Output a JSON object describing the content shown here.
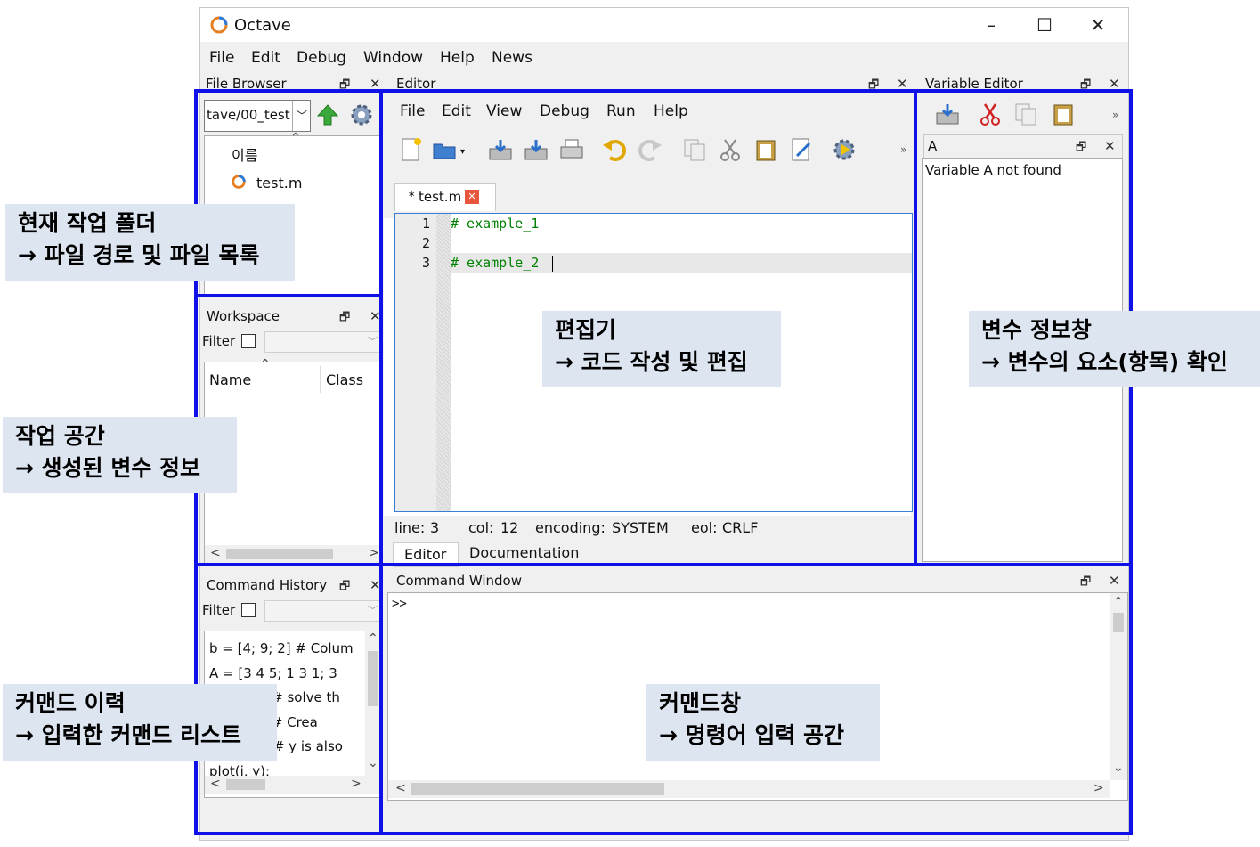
{
  "window": {
    "title": "Octave",
    "minimize": "–",
    "maximize": "☐",
    "close": "✕"
  },
  "menu": [
    "File",
    "Edit",
    "Debug",
    "Window",
    "Help",
    "News"
  ],
  "file_browser": {
    "title": "File Browser",
    "path": "tave/00_test",
    "column": "이름",
    "files": [
      "test.m"
    ]
  },
  "workspace": {
    "title": "Workspace",
    "filter_label": "Filter",
    "columns": [
      "Name",
      "Class"
    ]
  },
  "history": {
    "title": "Command History",
    "filter_label": "Filter",
    "items": [
      "b = [4; 9; 2] # Colum",
      "A = [3 4 5; 1 3 1; 3",
      "x = A \\ b # solve th",
      "i = 1:10; # Crea",
      "y = i.^2; # y is also",
      "plot(i, y);"
    ]
  },
  "editor": {
    "title": "Editor",
    "menu": [
      "File",
      "Edit",
      "View",
      "Debug",
      "Run",
      "Help"
    ],
    "tab": "test.m",
    "tab_marker": "∗",
    "lines": [
      {
        "num": "1",
        "text": "# example_1"
      },
      {
        "num": "2",
        "text": ""
      },
      {
        "num": "3",
        "text": "# example_2"
      }
    ],
    "status": {
      "line_label": "line:",
      "line": "3",
      "col_label": "col:",
      "col": "12",
      "enc_label": "encoding:",
      "enc": "SYSTEM",
      "eol_label": "eol:",
      "eol": "CRLF"
    },
    "bottom_tabs": [
      "Editor",
      "Documentation"
    ],
    "more": "»"
  },
  "variable_editor": {
    "title": "Variable Editor",
    "var_tab": "A",
    "message": "Variable A not found",
    "more": "»"
  },
  "command_window": {
    "title": "Command Window",
    "prompt": ">>"
  },
  "annotations": {
    "folder": [
      "현재 작업 폴더",
      "→ 파일 경로 및 파일 목록"
    ],
    "workspace": [
      "작업 공간",
      "→ 생성된 변수 정보"
    ],
    "history": [
      "커맨드 이력",
      "→ 입력한 커맨드 리스트"
    ],
    "editor": [
      "편집기",
      "→ 코드 작성 및 편집"
    ],
    "variable": [
      "변수 정보창",
      "→ 변수의 요소(항목) 확인"
    ],
    "command": [
      "커맨드창",
      "→ 명령어 입력 공간"
    ]
  },
  "colors": {
    "highlight_border": "#1010e8",
    "note_bg": "#dde5f1",
    "code_comment": "#008000"
  },
  "icons": {
    "file_browser": [
      "folder-up-icon",
      "settings-icon"
    ],
    "editor_toolbar": [
      "new-file-icon",
      "open-file-icon",
      "save-icon",
      "save-as-icon",
      "print-icon",
      "undo-icon",
      "redo-icon",
      "copy-icon",
      "cut-icon",
      "paste-icon",
      "find-icon",
      "run-icon"
    ],
    "variable_toolbar": [
      "save-icon",
      "cut-icon",
      "copy-icon",
      "paste-icon"
    ]
  }
}
